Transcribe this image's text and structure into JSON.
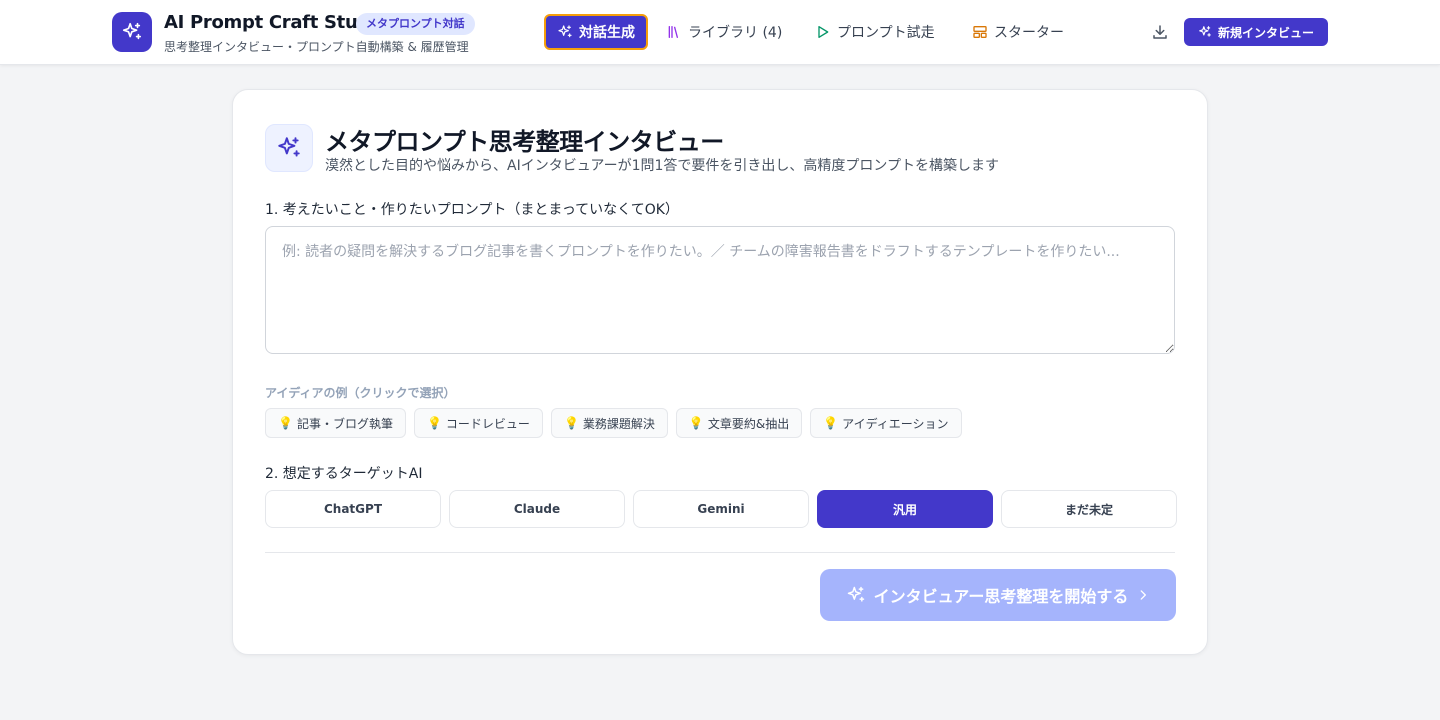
{
  "header": {
    "app_title": "AI Prompt Craft Studio",
    "badge": "メタプロンプト対話",
    "subtitle": "思考整理インタビュー・プロンプト自動構築 & 履歴管理",
    "nav": {
      "dialog": "対話生成",
      "library": "ライブラリ (4)",
      "test": "プロンプト試走",
      "starter": "スターター"
    },
    "new_interview": "新規インタビュー"
  },
  "card": {
    "title": "メタプロンプト思考整理インタビュー",
    "description": "漠然とした目的や悩みから、AIインタビュアーが1問1答で要件を引き出し、高精度プロンプトを構築します",
    "step1_label": "1. 考えたいこと・作りたいプロンプト（まとまっていなくてOK）",
    "idea_placeholder": "例: 読者の疑問を解決するブログ記事を書くプロンプトを作りたい。／ チームの障害報告書をドラフトするテンプレートを作りたい...",
    "idea_value": "",
    "examples_label": "アイディアの例（クリックで選択）",
    "examples": [
      "記事・ブログ執筆",
      "コードレビュー",
      "業務課題解決",
      "文章要約&抽出",
      "アイディエーション"
    ],
    "step2_label": "2. 想定するターゲットAI",
    "targets": [
      "ChatGPT",
      "Claude",
      "Gemini",
      "汎用",
      "まだ未定"
    ],
    "selected_target": "汎用",
    "start_button": "インタビュアー思考整理を開始する"
  },
  "colors": {
    "primary": "#4338ca",
    "active_outline": "#f59e0b",
    "disabled_primary": "#a5b4fc",
    "background": "#f3f4f6"
  },
  "icons": [
    "sparkles-icon",
    "library-icon",
    "play-icon",
    "layout-icon",
    "download-icon",
    "lightbulb-icon",
    "chevron-right-icon"
  ]
}
